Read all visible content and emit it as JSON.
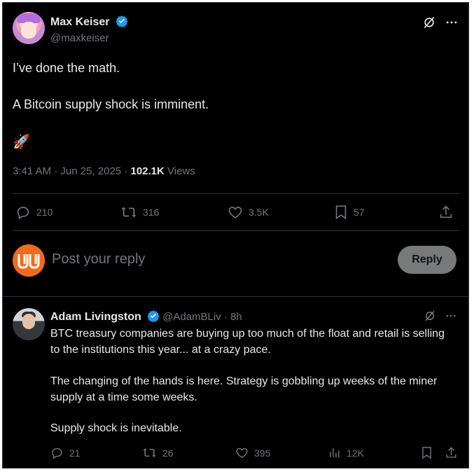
{
  "main_post": {
    "author_name": "Max Keiser",
    "author_handle": "@maxkeiser",
    "text_line1": "I’ve done the math.",
    "text_line2": "A Bitcoin supply shock is imminent.",
    "emoji": "🚀",
    "time": "3:41 AM",
    "date": "Jun 25, 2025",
    "views_count": "102.1K",
    "views_label": "Views",
    "stats": {
      "replies": "210",
      "reposts": "316",
      "likes": "3.5K",
      "bookmarks": "57"
    }
  },
  "composer": {
    "placeholder": "Post your reply",
    "button_label": "Reply"
  },
  "reply_post": {
    "author_name": "Adam Livingston",
    "author_handle": "@AdamBLiv",
    "age": "8h",
    "para1": "BTC treasury companies are buying up too much of the float and retail is selling to the institutions this year... at a crazy pace.",
    "para2": "The changing of the hands is here. Strategy is gobbling up weeks of the miner supply at a time some weeks.",
    "para3": "Supply shock is inevitable.",
    "stats": {
      "replies": "21",
      "reposts": "26",
      "likes": "395",
      "views": "12K"
    }
  },
  "colors": {
    "background": "#000000",
    "text_primary": "#e7e9ea",
    "text_secondary": "#71767b",
    "verified_blue": "#1d9bf0",
    "divider": "#2f3336",
    "reply_button": "#787a7a",
    "brand_orange": "#f26a1b"
  },
  "icons": [
    "verified-badge-icon",
    "grok-icon",
    "more-icon",
    "reply-icon",
    "repost-icon",
    "like-icon",
    "bookmark-icon",
    "share-icon",
    "views-icon",
    "rocket-emoji"
  ]
}
